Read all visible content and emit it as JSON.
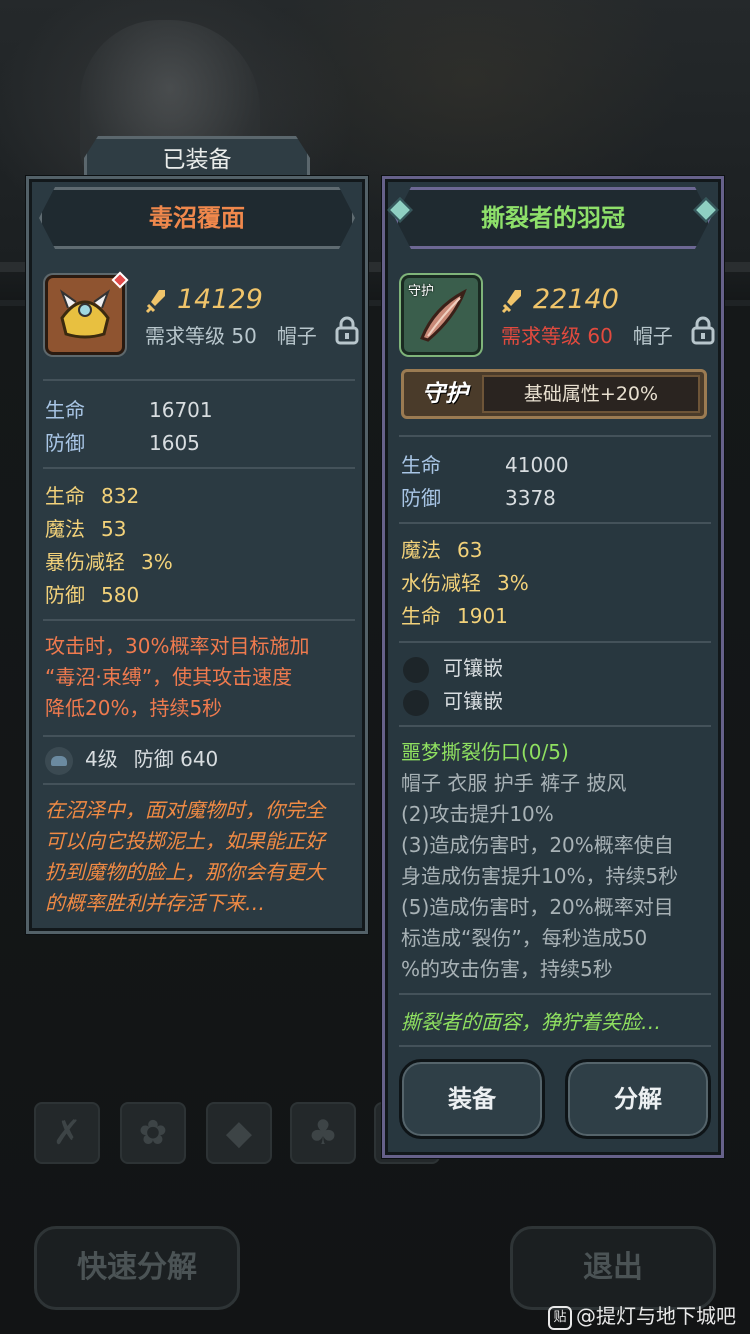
{
  "equipped_tab": "已装备",
  "left_item": {
    "name": "毒沼覆面",
    "score": "14129",
    "req_level": "需求等级 50",
    "slot": "帽子",
    "base_stats": [
      {
        "label": "生命",
        "value": "16701"
      },
      {
        "label": "防御",
        "value": "1605"
      }
    ],
    "extra_stats": [
      {
        "label": "生命",
        "value": "832"
      },
      {
        "label": "魔法",
        "value": "53"
      },
      {
        "label": "暴伤减轻",
        "value": "3%"
      },
      {
        "label": "防御",
        "value": "580"
      }
    ],
    "effect_lines": [
      "攻击时，30%概率对目标施加",
      "“毒沼·束缚”，使其攻击速度",
      "降低20%，持续5秒"
    ],
    "gem": {
      "level": "4级",
      "stat": "防御 640"
    },
    "flavor_lines": [
      "在沼泽中，面对魔物时，你完全",
      "可以向它投掷泥土，如果能正好",
      "扔到魔物的脸上，那你会有更大",
      "的概率胜利并存活下来…"
    ]
  },
  "right_item": {
    "name": "撕裂者的羽冠",
    "icon_label": "守护",
    "score": "22140",
    "req_level": "需求等级 60",
    "slot": "帽子",
    "guard_title": "守护",
    "guard_desc": "基础属性+20%",
    "base_stats": [
      {
        "label": "生命",
        "value": "41000"
      },
      {
        "label": "防御",
        "value": "3378"
      }
    ],
    "extra_stats": [
      {
        "label": "魔法",
        "value": "63"
      },
      {
        "label": "水伤减轻",
        "value": "3%"
      },
      {
        "label": "生命",
        "value": "1901"
      }
    ],
    "sockets": [
      "可镶嵌",
      "可镶嵌"
    ],
    "set_title": "噩梦撕裂伤口(0/5)",
    "set_lines": [
      "帽子 衣服 护手 裤子 披风",
      "(2)攻击提升10%",
      "(3)造成伤害时，20%概率使自",
      "身造成伤害提升10%，持续5秒",
      "(5)造成伤害时，20%概率对目",
      "标造成“裂伤”，每秒造成50",
      "%的攻击伤害，持续5秒"
    ],
    "flavor": "撕裂者的面容，狰狞着笑脸…",
    "equip_button": "装备",
    "dismantle_button": "分解"
  },
  "bottom": {
    "quick_dismantle": "快速分解",
    "exit": "退出"
  },
  "watermark": "@提灯与地下城吧",
  "watermark_icon": "贴",
  "colors": {
    "left_title": "#f0884c",
    "right_title": "#8ee06a",
    "score": "#f0c46a",
    "req_red": "#e24a3e",
    "effect_orange": "#ef7a4e",
    "set_green": "#8fe060"
  }
}
